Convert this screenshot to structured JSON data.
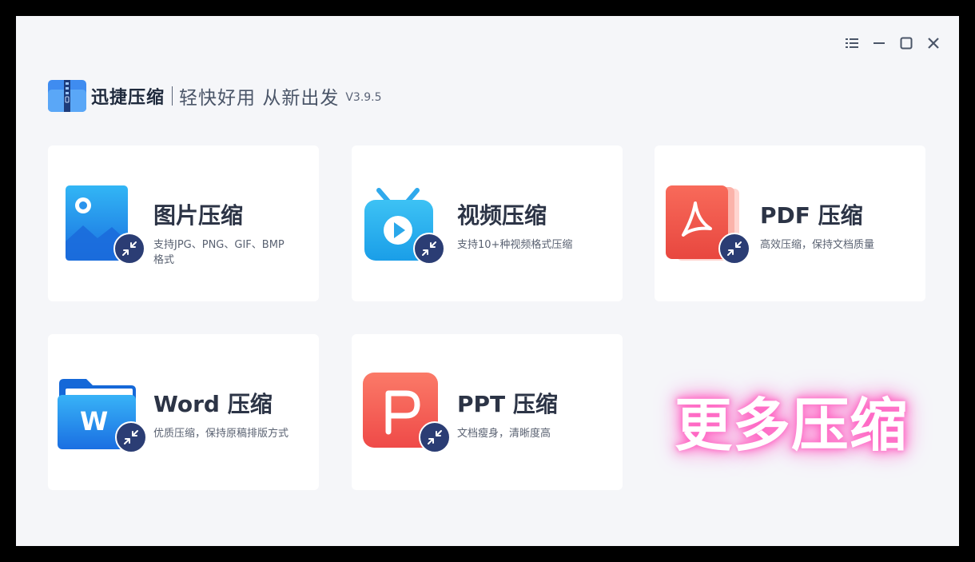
{
  "header": {
    "app_name": "迅捷压缩",
    "slogan": "轻快好用 从新出发",
    "version": "V3.9.5"
  },
  "window_controls": [
    "menu-icon",
    "minimize-icon",
    "maximize-icon",
    "close-icon"
  ],
  "cards": [
    {
      "title": "图片压缩",
      "desc": "支持JPG、PNG、GIF、BMP格式",
      "icon": "image-icon"
    },
    {
      "title": "视频压缩",
      "desc": "支持10+种视频格式压缩",
      "icon": "video-tv-icon"
    },
    {
      "title": "PDF 压缩",
      "desc": "高效压缩，保持文档质量",
      "icon": "pdf-icon"
    },
    {
      "title": "Word 压缩",
      "desc": "优质压缩，保持原稿排版方式",
      "icon": "word-folder-icon"
    },
    {
      "title": "PPT 压缩",
      "desc": "文档瘦身，清晰度高",
      "icon": "ppt-icon"
    }
  ],
  "more": {
    "label": "更多压缩"
  },
  "colors": {
    "window_bg": "#f5f6f9",
    "badge": "#2b3d74",
    "title": "#2c3446",
    "glow": "#ff6ec7"
  }
}
